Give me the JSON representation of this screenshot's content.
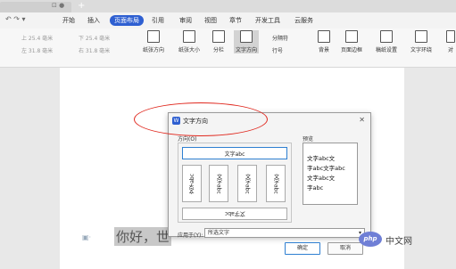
{
  "menu": {
    "items": [
      "开始",
      "插入",
      "页面布局",
      "引用",
      "审阅",
      "视图",
      "章节",
      "开发工具",
      "云服务"
    ],
    "active": "页面布局"
  },
  "ribbon": {
    "margin_top": "上 25.4 毫米",
    "margin_bottom": "下 25.4 毫米",
    "margin_left": "左 31.8 毫米",
    "margin_right": "右 31.8 毫米",
    "buttons": [
      "纸张方向",
      "纸张大小",
      "分栏",
      "文字方向",
      "分隔符",
      "行号",
      "背景",
      "页面边框",
      "稿纸设置",
      "文字环绕",
      "对"
    ]
  },
  "document": {
    "text": "你好，世"
  },
  "dialog": {
    "title": "文字方向",
    "direction_label": "方向(O)",
    "options": {
      "horizontal": "文字abc",
      "v1": "文字abc",
      "v2": "文字abc",
      "v3": "文字abc",
      "v4": "文字abc",
      "bottom": "文字abc"
    },
    "preview_label": "预览",
    "preview_lines": [
      "文字abc文",
      "字abc文字abc",
      "文字abc文",
      "字abc"
    ],
    "apply_label": "应用于(Y):",
    "apply_value": "所选文字",
    "ok": "确定",
    "cancel": "取消"
  },
  "watermark": {
    "logo": "php",
    "text": "中文网"
  },
  "colors": {
    "accent": "#2e5fd1",
    "annotation": "#e0281e"
  }
}
